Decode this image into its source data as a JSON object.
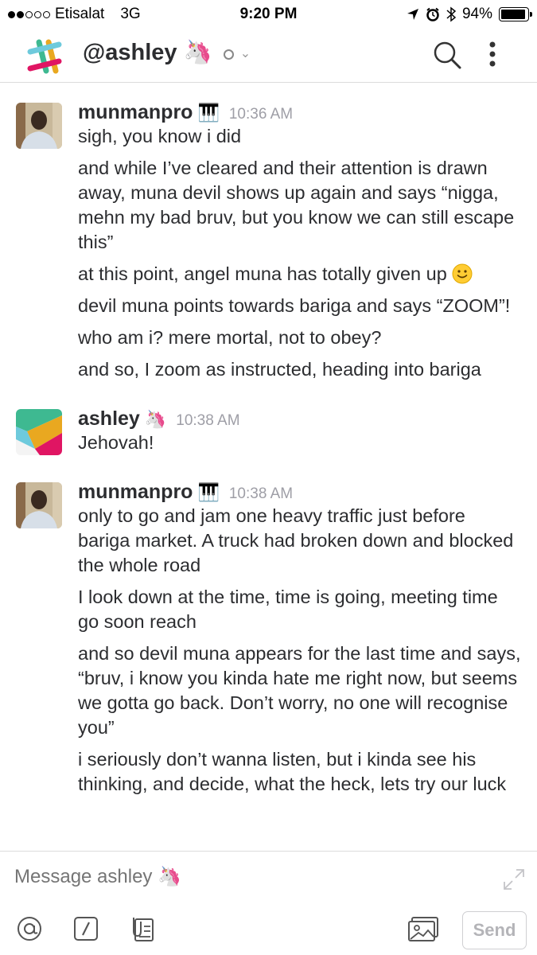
{
  "status_bar": {
    "carrier": "Etisalat",
    "network": "3G",
    "time": "9:20 PM",
    "battery": "94%",
    "battery_level": 0.94,
    "signal_bars": 2
  },
  "header": {
    "channel_name": "@ashley",
    "name_emoji": "🦄",
    "icons": [
      "slack-logo-icon",
      "presence-icon",
      "chevron-down-icon",
      "search-icon",
      "more-vertical-icon"
    ]
  },
  "messages": [
    {
      "sender": "munmanpro",
      "sender_emoji": "🎹",
      "time": "10:36 AM",
      "avatar": "photo-avatar",
      "lines": [
        "sigh, you know i did",
        "and while I’ve cleared and their attention is drawn away, muna devil shows up again and says “nigga, mehn my bad bruv, but you know we can still escape this”",
        "at this point, angel muna has totally given up",
        "devil muna points towards bariga and says “ZOOM”!",
        "who am i? mere mortal, not to obey?",
        "and so, I zoom as instructed, heading into bariga"
      ]
    },
    {
      "sender": "ashley",
      "sender_emoji": "🦄",
      "time": "10:38 AM",
      "avatar": "slack-default-avatar",
      "lines": [
        "Jehovah!"
      ]
    },
    {
      "sender": "munmanpro",
      "sender_emoji": "🎹",
      "time": "10:38 AM",
      "avatar": "photo-avatar",
      "lines": [
        "only to go and jam one heavy traffic just before bariga market. A truck had broken down and blocked the whole road",
        "I look down at the time, time is going, meeting time go soon reach",
        "and so devil muna appears for the last time and says, “bruv, i know you kinda hate me right now, but seems we gotta go back. Don’t worry, no one will recognise you”",
        "i seriously don’t wanna listen, but i kinda see his thinking, and decide, what the heck, lets try our luck"
      ]
    }
  ],
  "composer": {
    "placeholder": "Message ashley 🦄",
    "send_label": "Send",
    "tools": [
      "at-mention-icon",
      "slash-command-icon",
      "file-upload-icon",
      "photo-icon"
    ]
  },
  "colors": {
    "text": "#2c2d30",
    "muted": "#9e9ea6",
    "divider": "#dcdcdc"
  }
}
